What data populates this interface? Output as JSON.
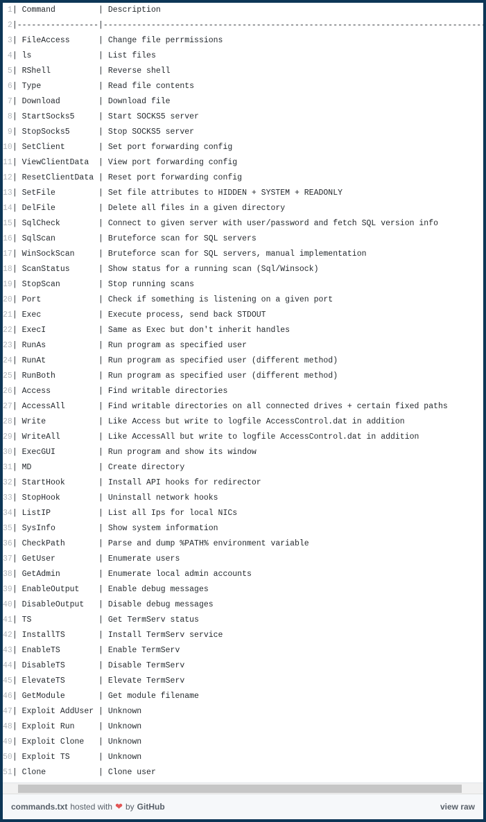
{
  "rows": [
    {
      "n": 1,
      "cmd": "Command",
      "desc": "Description",
      "sep": false
    },
    {
      "n": 2,
      "sep": true
    },
    {
      "n": 3,
      "cmd": "FileAccess",
      "desc": "Change file perrmissions"
    },
    {
      "n": 4,
      "cmd": "ls",
      "desc": "List files"
    },
    {
      "n": 5,
      "cmd": "RShell",
      "desc": "Reverse shell"
    },
    {
      "n": 6,
      "cmd": "Type",
      "desc": "Read file contents"
    },
    {
      "n": 7,
      "cmd": "Download",
      "desc": "Download file"
    },
    {
      "n": 8,
      "cmd": "StartSocks5",
      "desc": "Start SOCKS5 server"
    },
    {
      "n": 9,
      "cmd": "StopSocks5",
      "desc": "Stop SOCKS5 server"
    },
    {
      "n": 10,
      "cmd": "SetClient",
      "desc": "Set port forwarding config"
    },
    {
      "n": 11,
      "cmd": "ViewClientData",
      "desc": "View port forwarding config"
    },
    {
      "n": 12,
      "cmd": "ResetClientData",
      "desc": "Reset port forwarding config"
    },
    {
      "n": 13,
      "cmd": "SetFile",
      "desc": "Set file attributes to HIDDEN + SYSTEM + READONLY"
    },
    {
      "n": 14,
      "cmd": "DelFile",
      "desc": "Delete all files in a given directory"
    },
    {
      "n": 15,
      "cmd": "SqlCheck",
      "desc": "Connect to given server with user/password and fetch SQL version info"
    },
    {
      "n": 16,
      "cmd": "SqlScan",
      "desc": "Bruteforce scan for SQL servers"
    },
    {
      "n": 17,
      "cmd": "WinSockScan",
      "desc": "Bruteforce scan for SQL servers, manual implementation"
    },
    {
      "n": 18,
      "cmd": "ScanStatus",
      "desc": "Show status for a running scan (Sql/Winsock)"
    },
    {
      "n": 19,
      "cmd": "StopScan",
      "desc": "Stop running scans"
    },
    {
      "n": 20,
      "cmd": "Port",
      "desc": "Check if something is listening on a given port"
    },
    {
      "n": 21,
      "cmd": "Exec",
      "desc": "Execute process, send back STDOUT"
    },
    {
      "n": 22,
      "cmd": "ExecI",
      "desc": "Same as Exec but don't inherit handles"
    },
    {
      "n": 23,
      "cmd": "RunAs",
      "desc": "Run program as specified user"
    },
    {
      "n": 24,
      "cmd": "RunAt",
      "desc": "Run program as specified user (different method)"
    },
    {
      "n": 25,
      "cmd": "RunBoth",
      "desc": "Run program as specified user (different method)"
    },
    {
      "n": 26,
      "cmd": "Access",
      "desc": "Find writable directories"
    },
    {
      "n": 27,
      "cmd": "AccessAll",
      "desc": "Find writable directories on all connected drives + certain fixed paths"
    },
    {
      "n": 28,
      "cmd": "Write",
      "desc": "Like Access but write to logfile AccessControl.dat in addition"
    },
    {
      "n": 29,
      "cmd": "WriteAll",
      "desc": "Like AccessAll but write to logfile AccessControl.dat in addition"
    },
    {
      "n": 30,
      "cmd": "ExecGUI",
      "desc": "Run program and show its window"
    },
    {
      "n": 31,
      "cmd": "MD",
      "desc": "Create directory"
    },
    {
      "n": 32,
      "cmd": "StartHook",
      "desc": "Install API hooks for redirector"
    },
    {
      "n": 33,
      "cmd": "StopHook",
      "desc": "Uninstall network hooks"
    },
    {
      "n": 34,
      "cmd": "ListIP",
      "desc": "List all Ips for local NICs"
    },
    {
      "n": 35,
      "cmd": "SysInfo",
      "desc": "Show system information"
    },
    {
      "n": 36,
      "cmd": "CheckPath",
      "desc": "Parse and dump %PATH% environment variable"
    },
    {
      "n": 37,
      "cmd": "GetUser",
      "desc": "Enumerate users"
    },
    {
      "n": 38,
      "cmd": "GetAdmin",
      "desc": "Enumerate local admin accounts"
    },
    {
      "n": 39,
      "cmd": "EnableOutput",
      "desc": "Enable debug messages"
    },
    {
      "n": 40,
      "cmd": "DisableOutput",
      "desc": "Disable debug messages"
    },
    {
      "n": 41,
      "cmd": "TS",
      "desc": "Get TermServ status"
    },
    {
      "n": 42,
      "cmd": "InstallTS",
      "desc": "Install TermServ service"
    },
    {
      "n": 43,
      "cmd": "EnableTS",
      "desc": "Enable TermServ"
    },
    {
      "n": 44,
      "cmd": "DisableTS",
      "desc": "Disable TermServ"
    },
    {
      "n": 45,
      "cmd": "ElevateTS",
      "desc": "Elevate TermServ"
    },
    {
      "n": 46,
      "cmd": "GetModule",
      "desc": "Get module filename"
    },
    {
      "n": 47,
      "cmd": "Exploit AddUser",
      "desc": "Unknown"
    },
    {
      "n": 48,
      "cmd": "Exploit Run",
      "desc": "Unknown"
    },
    {
      "n": 49,
      "cmd": "Exploit Clone",
      "desc": "Unknown"
    },
    {
      "n": 50,
      "cmd": "Exploit TS",
      "desc": "Unknown"
    },
    {
      "n": 51,
      "cmd": "Clone",
      "desc": "Clone user"
    }
  ],
  "cmd_width": 16,
  "sep_cmd": "|-----------------|",
  "sep_desc_char": "-",
  "sep_desc_len": 120,
  "footer": {
    "filename": "commands.txt",
    "hosted": "hosted with",
    "by": "by",
    "github": "GitHub",
    "view_raw": "view raw"
  }
}
